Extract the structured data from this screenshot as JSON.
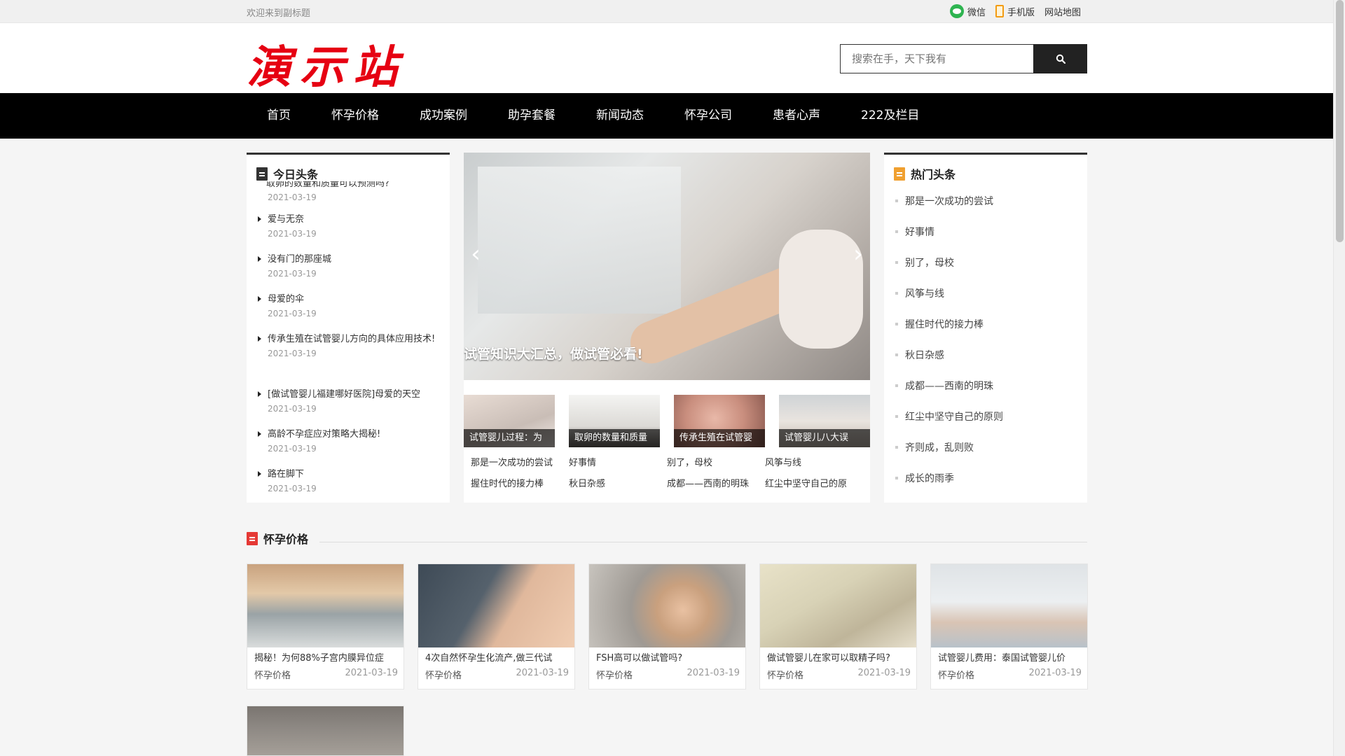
{
  "topbar": {
    "welcome": "欢迎来到副标题",
    "links": [
      {
        "icon": "wechat-icon",
        "label": "微信"
      },
      {
        "icon": "phone-icon",
        "label": "手机版"
      },
      {
        "label": "网站地图"
      }
    ]
  },
  "header": {
    "logo": "演示站",
    "search": {
      "placeholder": "搜索在手，天下我有",
      "button_icon": "search-icon"
    }
  },
  "nav": {
    "items": [
      "首页",
      "怀孕价格",
      "成功案例",
      "助孕套餐",
      "新闻动态",
      "怀孕公司",
      "患者心声",
      "222及栏目"
    ]
  },
  "today": {
    "title": "今日头条",
    "cut_item": "取卵的数量和质量可以预测吗?",
    "items": [
      {
        "title": "爱与无奈",
        "date": "2021-03-19"
      },
      {
        "title": "没有门的那座城",
        "date": "2021-03-19"
      },
      {
        "title": "母爱的伞",
        "date": "2021-03-19"
      },
      {
        "title": "传承生殖在试管婴儿方向的具体应用技术!",
        "date": "2021-03-19"
      },
      {
        "title": "[做试管婴儿福建哪好医院]母爱的天空",
        "date": "2021-03-19"
      },
      {
        "title": "高龄不孕症应对策略大揭秘!",
        "date": "2021-03-19"
      },
      {
        "title": "路在脚下",
        "date": "2021-03-19"
      }
    ],
    "first_date": "2021-03-19"
  },
  "slider": {
    "caption": "试管知识大汇总，做试管必看!",
    "thumbs": [
      "试管婴儿过程：为",
      "取卵的数量和质量",
      "传承生殖在试管婴",
      "试管婴儿八大误"
    ],
    "links_row1": [
      "那是一次成功的尝试",
      "好事情",
      "别了，母校",
      "风筝与线"
    ],
    "links_row2": [
      "握住时代的接力棒",
      "秋日杂感",
      "成都——西南的明珠",
      "红尘中坚守自己的原"
    ]
  },
  "hot": {
    "title": "热门头条",
    "items": [
      "那是一次成功的尝试",
      "好事情",
      "别了，母校",
      "风筝与线",
      "握住时代的接力棒",
      "秋日杂感",
      "成都——西南的明珠",
      "红尘中坚守自己的原则",
      "齐则成，乱则败",
      "成长的雨季"
    ]
  },
  "section": {
    "title": "怀孕价格",
    "cards": [
      {
        "title": "揭秘！为何88%子宫内膜异位症",
        "category": "怀孕价格",
        "date": "2021-03-19"
      },
      {
        "title": "4次自然怀孕生化流产,做三代试",
        "category": "怀孕价格",
        "date": "2021-03-19"
      },
      {
        "title": "FSH高可以做试管吗?",
        "category": "怀孕价格",
        "date": "2021-03-19"
      },
      {
        "title": "做试管婴儿在家可以取精子吗?",
        "category": "怀孕价格",
        "date": "2021-03-19"
      },
      {
        "title": "试管婴儿费用：泰国试管婴儿价",
        "category": "怀孕价格",
        "date": "2021-03-19"
      }
    ]
  }
}
